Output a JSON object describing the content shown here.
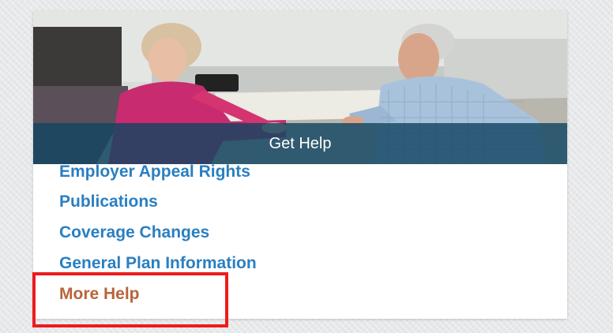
{
  "panel": {
    "caption": "Get Help",
    "links": [
      "Employer Appeal Rights",
      "Publications",
      "Coverage Changes",
      "General Plan Information"
    ],
    "more_help": "More Help"
  },
  "colors": {
    "link": "#2a7fc1",
    "more_help": "#b8643a",
    "caption_band": "#124662",
    "highlight": "#ee1c1c"
  },
  "image": {
    "icon": "photo-two-people-consultation"
  }
}
